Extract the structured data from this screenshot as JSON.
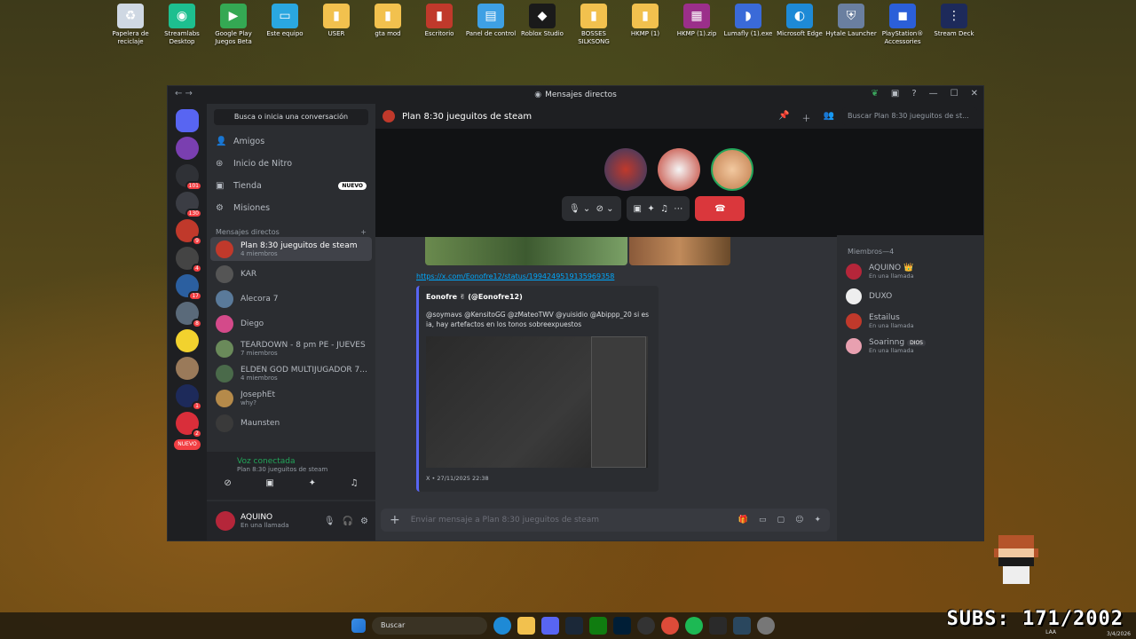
{
  "desktop": [
    {
      "label": "Papelera de reciclaje",
      "color": "#cfd8e3",
      "glyph": "♻"
    },
    {
      "label": "Streamlabs Desktop",
      "color": "#1dbf8f",
      "glyph": "◉"
    },
    {
      "label": "Google Play Juegos Beta",
      "color": "#34a853",
      "glyph": "▶"
    },
    {
      "label": "Este equipo",
      "color": "#2aa7e0",
      "glyph": "▭"
    },
    {
      "label": "USER",
      "color": "#f2c14e",
      "glyph": "▮"
    },
    {
      "label": "gta mod",
      "color": "#f2c14e",
      "glyph": "▮"
    },
    {
      "label": "Escritorio",
      "color": "#c0392b",
      "glyph": "▮"
    },
    {
      "label": "Panel de control",
      "color": "#3ea0e4",
      "glyph": "▤"
    },
    {
      "label": "Roblox Studio",
      "color": "#1a1a1a",
      "glyph": "◆"
    },
    {
      "label": "BOSSES SILKSONG",
      "color": "#f2c14e",
      "glyph": "▮"
    },
    {
      "label": "HKMP (1)",
      "color": "#f2c14e",
      "glyph": "▮"
    },
    {
      "label": "HKMP (1).zip",
      "color": "#9b2f8a",
      "glyph": "▦"
    },
    {
      "label": "Lumafly (1).exe",
      "color": "#3a6ad8",
      "glyph": "◗"
    },
    {
      "label": "Microsoft Edge",
      "color": "#1e8ad6",
      "glyph": "◐"
    },
    {
      "label": "Hytale Launcher",
      "color": "#6a7fa0",
      "glyph": "⛨"
    },
    {
      "label": "PlayStation® Accessories",
      "color": "#2b5fd9",
      "glyph": "◼"
    },
    {
      "label": "Stream Deck",
      "color": "#1d2a5a",
      "glyph": "⋮"
    }
  ],
  "window": {
    "title": "Mensajes directos",
    "nav": "← →",
    "controls": [
      "—",
      "☐",
      "✕"
    ]
  },
  "servers": [
    {
      "color": "#5865f2",
      "badge": ""
    },
    {
      "color": "#7a3fb0",
      "badge": ""
    },
    {
      "color": "#2f3136",
      "badge": "101"
    },
    {
      "color": "#3b3d44",
      "badge": "130"
    },
    {
      "color": "#c0392b",
      "badge": "9"
    },
    {
      "color": "#444",
      "badge": "4"
    },
    {
      "color": "#2b5fa0",
      "badge": "17"
    },
    {
      "color": "#5a6a7a",
      "badge": "8"
    },
    {
      "color": "#f2d22e",
      "badge": ""
    },
    {
      "color": "#9a7a5a",
      "badge": ""
    },
    {
      "color": "#1d2a5a",
      "badge": "1"
    },
    {
      "color": "#d92e3a",
      "badge": "2"
    }
  ],
  "new_label": "NUEVO",
  "sidebar": {
    "search": "Busca o inicia una conversación",
    "nav": [
      {
        "label": "Amigos",
        "icon": "👤"
      },
      {
        "label": "Inicio de Nitro",
        "icon": "⊛"
      },
      {
        "label": "Tienda",
        "icon": "▣",
        "badge": "NUEVO"
      },
      {
        "label": "Misiones",
        "icon": "⚙"
      }
    ],
    "dm_header": "Mensajes directos",
    "dm_add": "+",
    "dms": [
      {
        "name": "Plan 8:30 jueguitos de steam",
        "sub": "4 miembros",
        "color": "#c0392b",
        "active": true
      },
      {
        "name": "KAR",
        "sub": "",
        "color": "#555"
      },
      {
        "name": "Alecora 7",
        "sub": "",
        "color": "#5a7a9a"
      },
      {
        "name": "Diego",
        "sub": "",
        "color": "#d44a8a"
      },
      {
        "name": "TEARDOWN - 8 pm PE - JUEVES",
        "sub": "7 miembros",
        "color": "#6a8a5a"
      },
      {
        "name": "ELDEN GOD MULTIJUGADOR 7...",
        "sub": "4 miembros",
        "color": "#4a6a4a"
      },
      {
        "name": "JosephEt",
        "sub": "why?",
        "color": "#b58a4a"
      },
      {
        "name": "Maunsten",
        "sub": "",
        "color": "#3a3a3a"
      }
    ],
    "voice": {
      "status": "Voz conectada",
      "channel": "Plan 8:30 jueguitos de steam"
    },
    "user": {
      "name": "AQUINO",
      "status": "En una llamada"
    }
  },
  "chat": {
    "title": "Plan 8:30 jueguitos de steam",
    "search": "Buscar Plan 8:30 jueguitos de st...",
    "link": "https://x.com/Eonofre12/status/1994249519135969358",
    "embed_author": "Eonofre ✌ (@Eonofre12)",
    "embed_text": "@soymavs @KensitoGG @zMateoTWV @yuisidio @Abippp_20 si es ia, hay artefactos en los tonos sobreexpuestos",
    "embed_footer": "X • 27/11/2025 22:38",
    "composer": "Enviar mensaje a Plan 8:30 jueguitos de steam"
  },
  "members": {
    "header": "Miembros—4",
    "list": [
      {
        "name": "AQUINO 👑",
        "status": "En una llamada",
        "color": "#b5263a",
        "tag": ""
      },
      {
        "name": "DUXO",
        "status": "",
        "color": "#eee",
        "tag": ""
      },
      {
        "name": "Estailus",
        "status": "En una llamada",
        "color": "#c0392b",
        "tag": ""
      },
      {
        "name": "Soarinng",
        "status": "En una llamada",
        "color": "#e8a0b0",
        "tag": "DIOS"
      }
    ]
  },
  "taskbar": {
    "search": "Buscar",
    "subs": "SUBS: 171/2002",
    "lang": "LAA",
    "date": "3/4/2026"
  }
}
